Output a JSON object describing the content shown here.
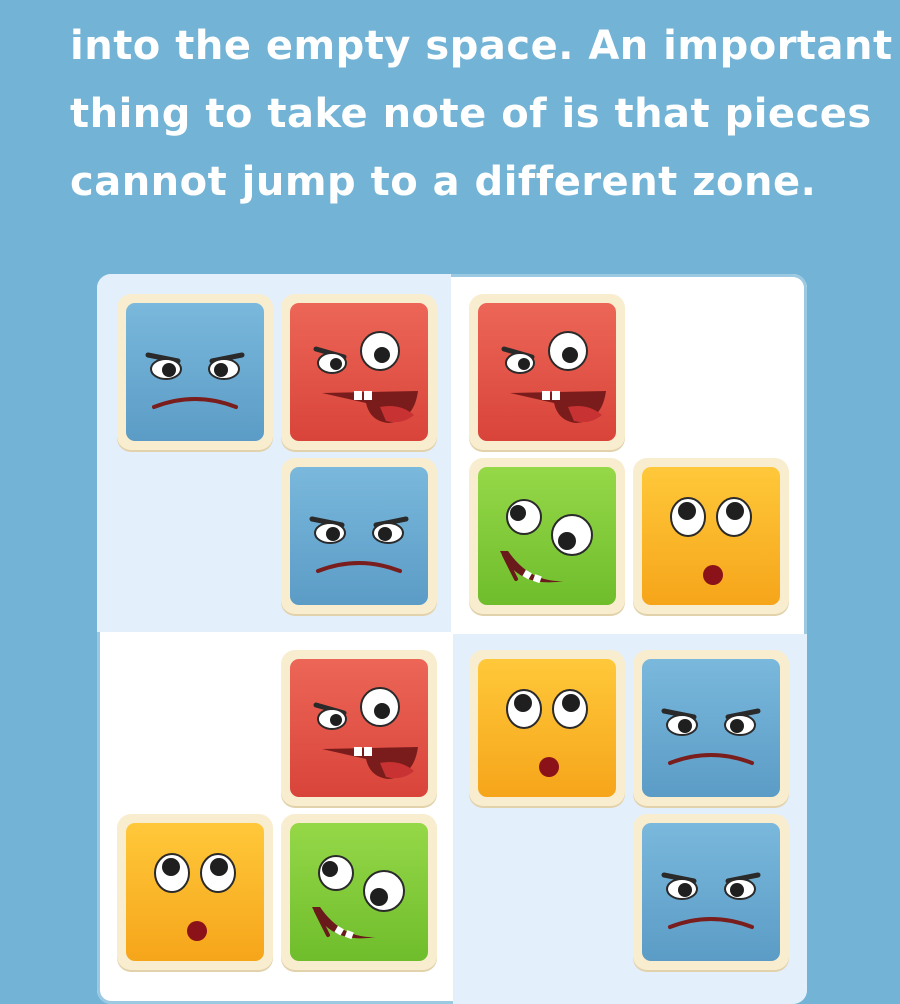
{
  "caption": {
    "lines": [
      "into the empty space. An important",
      "thing to take note of is that pieces",
      "cannot jump to a different zone."
    ]
  },
  "colors": {
    "background": "#72b3d6",
    "zone_tinted": "#e3effa",
    "zone_plain": "#ffffff",
    "tile_border": "#f9edd0",
    "blue": "#6aaad2",
    "red": "#e3544a",
    "green": "#82cc3a",
    "yellow": "#fbb628"
  },
  "board": {
    "rows": 4,
    "cols": 4,
    "zones": [
      {
        "name": "top-left",
        "tinted": true
      },
      {
        "name": "top-right",
        "tinted": false
      },
      {
        "name": "bottom-left",
        "tinted": false
      },
      {
        "name": "bottom-right",
        "tinted": true
      }
    ],
    "cells": [
      [
        "blue-angry",
        "red-crazy",
        "red-crazy",
        "empty"
      ],
      [
        "empty",
        "blue-angry",
        "green-silly",
        "yellow-surprised"
      ],
      [
        "empty",
        "red-crazy",
        "yellow-surprised",
        "blue-angry"
      ],
      [
        "yellow-surprised",
        "green-silly",
        "empty",
        "blue-angry"
      ]
    ]
  }
}
